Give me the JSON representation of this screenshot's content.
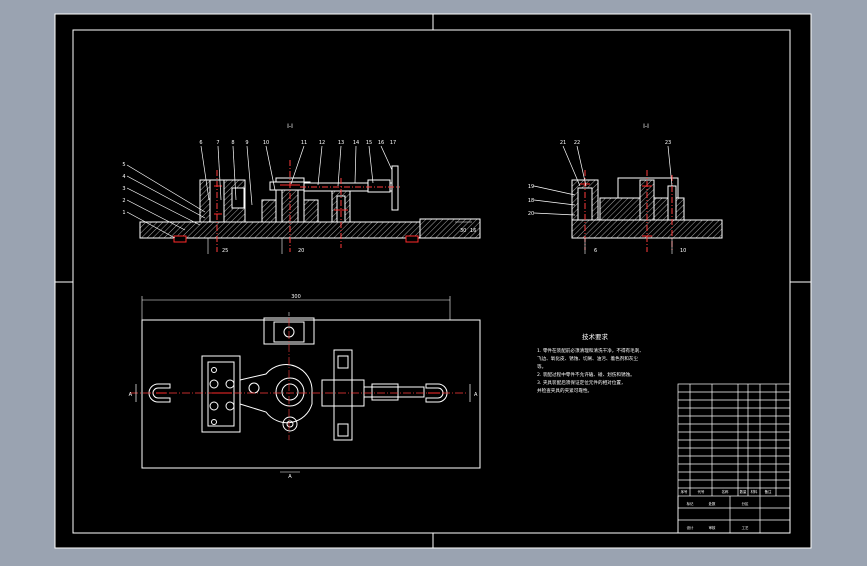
{
  "drawing": {
    "background": "#000000",
    "frame_color": "#ffffff",
    "hatch_color": "#d9d9d9",
    "section_color": "#ff2a2a",
    "center_line_color": "#ff3b3b",
    "dim_color": "#ffffff"
  },
  "views": {
    "front_section_label": "I-I",
    "side_section_label": "I-I",
    "front_callouts": [
      "1",
      "2",
      "3",
      "4",
      "5",
      "6",
      "7",
      "8",
      "9",
      "10",
      "11",
      "12",
      "13",
      "14",
      "15",
      "16",
      "17"
    ],
    "side_callouts": [
      "21",
      "22",
      "23",
      "19",
      "18",
      "20"
    ],
    "front_dims": [
      "25",
      "20",
      "30",
      "16"
    ],
    "side_dims": [
      "6",
      "10"
    ],
    "plan_dim_top": "300",
    "plan_dim_left": "A",
    "plan_dim_right": "A",
    "plan_dim_bottom": "A",
    "plan_dim_small": "I"
  },
  "notes": {
    "title": "技术要求",
    "lines": [
      "1. 零件在装配前必须清理和清洗干净，不得有毛刺、",
      "飞边、氧化皮、锈蚀、切屑、油污、着色剂和灰尘",
      "等。",
      "2. 装配过程中零件不允许磕、碰、划伤和锈蚀。",
      "3. 夹具装配后须保证定位元件的相对位置，",
      "并检查夹具的夹紧可靠性。"
    ]
  },
  "title_block": {
    "rows": 14,
    "header": [
      "序号",
      "代号",
      "名称",
      "数量",
      "材料",
      "备注"
    ],
    "footer_labels": [
      "标记",
      "处数",
      "分区",
      "设计",
      "审核",
      "工艺"
    ]
  }
}
